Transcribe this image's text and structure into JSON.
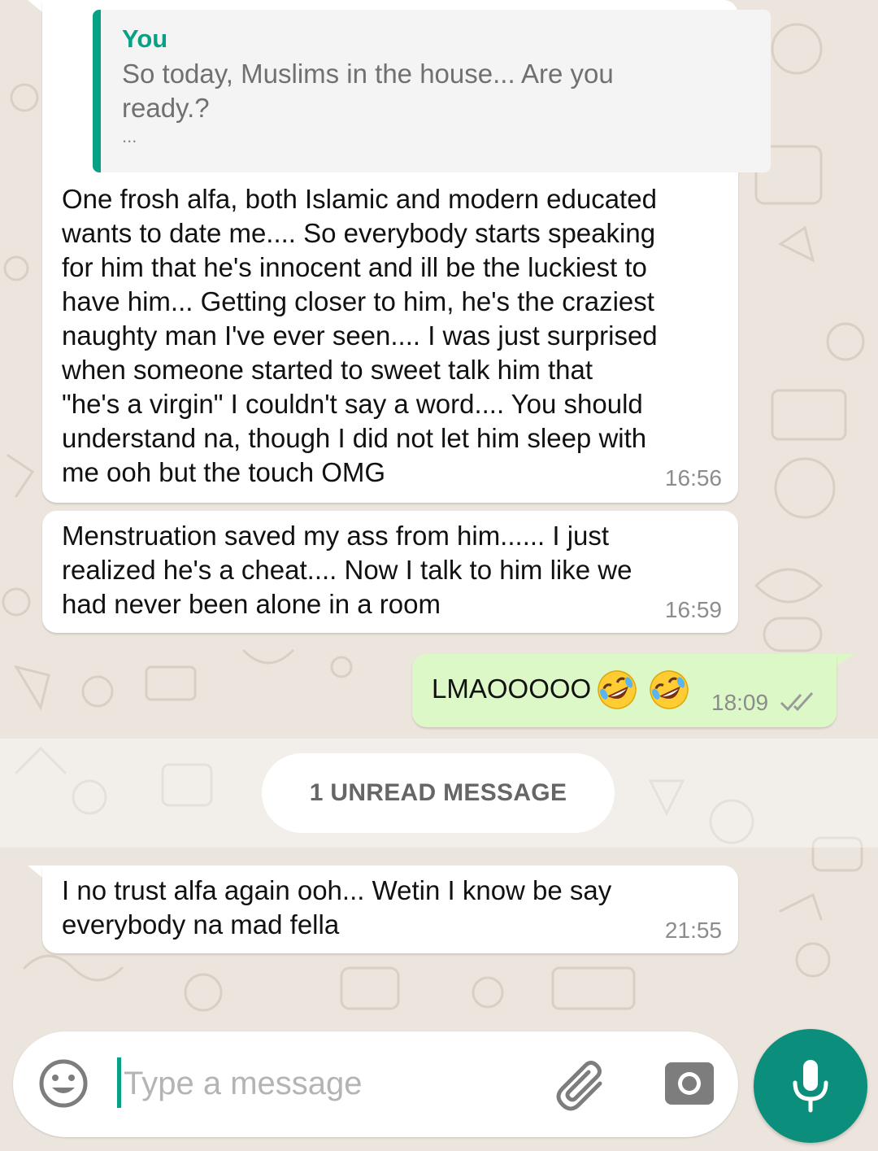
{
  "colors": {
    "wallpaper": "#ece5dd",
    "incoming_bubble": "#ffffff",
    "outgoing_bubble": "#dcf8c6",
    "accent": "#07a185",
    "mic_button": "#0b8f7c"
  },
  "messages": [
    {
      "direction": "incoming",
      "quote": {
        "author": "You",
        "text": "So today, Muslims in the house... Are you\nready.?",
        "ellipsis": "..."
      },
      "text": "One frosh alfa, both Islamic and modern educated\nwants to date me.... So everybody starts speaking\nfor him that he's innocent and ill be the luckiest to\nhave him... Getting closer to him, he's the craziest\nnaughty man I've ever seen.... I was just surprised\nwhen someone started to sweet talk him that\n\"he's a virgin\" I couldn't say a word.... You should\nunderstand na, though I did not let him sleep with\nme ooh but the touch OMG",
      "time": "16:56"
    },
    {
      "direction": "incoming",
      "text": "Menstruation saved my ass from him...... I just\nrealized he's a cheat.... Now I talk to him like we\nhad never been alone in a room",
      "time": "16:59"
    },
    {
      "direction": "outgoing",
      "text": "LMAOOOOO",
      "emojis": [
        "rolling-on-floor-laughing-emoji",
        "rolling-on-floor-laughing-emoji"
      ],
      "time": "18:09",
      "status": "read-double-check"
    },
    {
      "direction": "incoming",
      "text": "I no trust alfa again ooh... Wetin I know be say\neverybody na mad fella",
      "time": "21:55"
    }
  ],
  "unread_divider": {
    "label": "1 UNREAD MESSAGE"
  },
  "composer": {
    "placeholder": "Type a message",
    "icons": [
      "emoji-icon",
      "attach-icon",
      "camera-icon",
      "mic-icon"
    ]
  }
}
